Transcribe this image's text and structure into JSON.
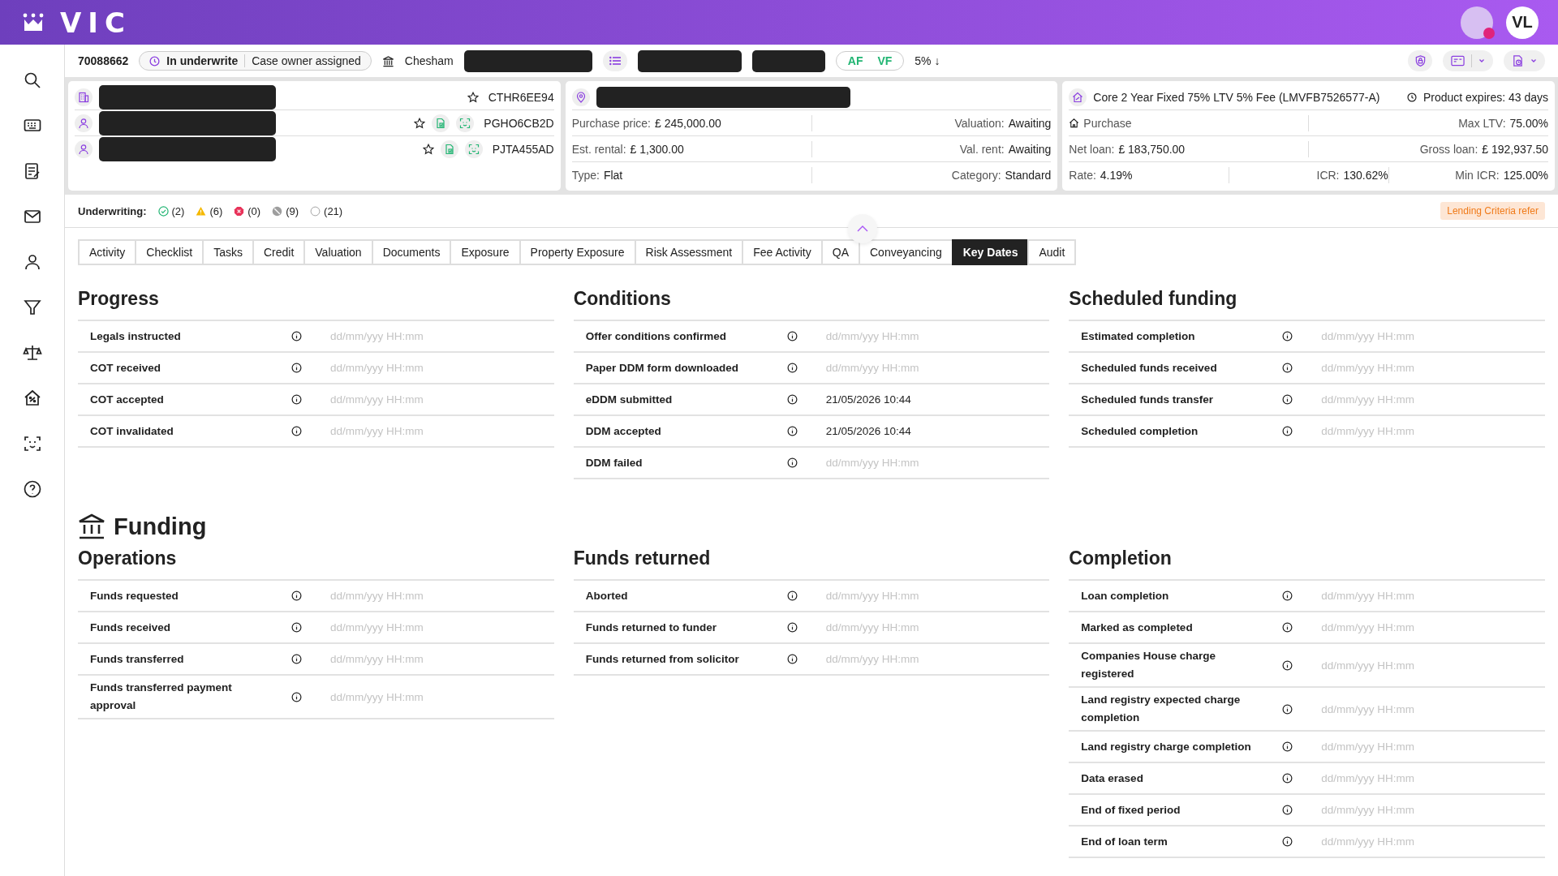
{
  "app": {
    "logo": "VIC",
    "user_initials": "VL"
  },
  "case_bar": {
    "case_number": "70088662",
    "status": "In underwrite",
    "substatus": "Case owner assigned",
    "branch": "Chesham",
    "flags": [
      "AF",
      "VF"
    ],
    "rate_change": "5% ↓"
  },
  "applicants_card": {
    "rows": [
      {
        "kind": "company",
        "reference": "CTHR6EE94",
        "starred": false,
        "has_docs": false
      },
      {
        "kind": "person",
        "reference": "PGHO6CB2D",
        "starred": false,
        "has_docs": true
      },
      {
        "kind": "person",
        "reference": "PJTA455AD",
        "starred": false,
        "has_docs": true
      }
    ]
  },
  "property_card": {
    "rows": [
      [
        {
          "label": "Purchase price:",
          "value": "£ 245,000.00"
        },
        {
          "label": "Valuation:",
          "value": "Awaiting"
        }
      ],
      [
        {
          "label": "Est. rental:",
          "value": "£ 1,300.00"
        },
        {
          "label": "Val. rent:",
          "value": "Awaiting"
        }
      ],
      [
        {
          "label": "Type:",
          "value": "Flat"
        },
        {
          "label": "Category:",
          "value": "Standard"
        }
      ]
    ]
  },
  "product_card": {
    "product": "Core 2 Year Fixed 75% LTV 5% Fee (LMVFB7526577-A)",
    "expiry": "Product expires: 43 days",
    "rows": [
      [
        {
          "label": "Purchase",
          "kind": "type"
        },
        {
          "label": "Max LTV:",
          "value": "75.00%"
        }
      ],
      [
        {
          "label": "Net loan:",
          "value": "£ 183,750.00"
        },
        {
          "label": "Gross loan:",
          "value": "£ 192,937.50"
        }
      ],
      [
        {
          "label": "Rate:",
          "value": "4.19%"
        },
        {
          "label": "ICR:",
          "value": "130.62%"
        },
        {
          "label": "Min ICR:",
          "value": "125.00%"
        }
      ]
    ]
  },
  "underwriting": {
    "label": "Underwriting:",
    "counts": [
      {
        "kind": "passed",
        "count": "(2)"
      },
      {
        "kind": "warning",
        "count": "(6)"
      },
      {
        "kind": "failed",
        "count": "(0)"
      },
      {
        "kind": "skipped",
        "count": "(9)"
      },
      {
        "kind": "pending",
        "count": "(21)"
      }
    ],
    "badge": "Lending Criteria refer"
  },
  "tabs": [
    {
      "label": "Activity",
      "selected": false
    },
    {
      "label": "Checklist",
      "selected": false
    },
    {
      "label": "Tasks",
      "selected": false
    },
    {
      "label": "Credit",
      "selected": false
    },
    {
      "label": "Valuation",
      "selected": false
    },
    {
      "label": "Documents",
      "selected": false
    },
    {
      "label": "Exposure",
      "selected": false
    },
    {
      "label": "Property Exposure",
      "selected": false
    },
    {
      "label": "Risk Assessment",
      "selected": false
    },
    {
      "label": "Fee Activity",
      "selected": false
    },
    {
      "label": "QA",
      "selected": false
    },
    {
      "label": "Conveyancing",
      "selected": false
    },
    {
      "label": "Key Dates",
      "selected": true
    },
    {
      "label": "Audit",
      "selected": false
    }
  ],
  "sections": [
    {
      "groups": [
        {
          "title": "Progress",
          "rows": [
            {
              "label": "Legals instructed",
              "placeholder": "dd/mm/yyy HH:mm"
            },
            {
              "label": "COT received",
              "placeholder": "dd/mm/yyy HH:mm"
            },
            {
              "label": "COT accepted",
              "placeholder": "dd/mm/yyy HH:mm"
            },
            {
              "label": "COT invalidated",
              "placeholder": "dd/mm/yyy HH:mm"
            }
          ]
        },
        {
          "title": "Conditions",
          "rows": [
            {
              "label": "Offer conditions confirmed",
              "placeholder": "dd/mm/yyy HH:mm"
            },
            {
              "label": "Paper DDM form downloaded",
              "placeholder": "dd/mm/yyy HH:mm"
            },
            {
              "label": "eDDM submitted",
              "value": "21/05/2026 10:44"
            },
            {
              "label": "DDM accepted",
              "value": "21/05/2026 10:44"
            },
            {
              "label": "DDM failed",
              "placeholder": "dd/mm/yyy HH:mm"
            }
          ]
        },
        {
          "title": "Scheduled funding",
          "rows": [
            {
              "label": "Estimated completion",
              "placeholder": "dd/mm/yyy HH:mm"
            },
            {
              "label": "Scheduled funds received",
              "placeholder": "dd/mm/yyy HH:mm"
            },
            {
              "label": "Scheduled funds transfer",
              "placeholder": "dd/mm/yyy HH:mm"
            },
            {
              "label": "Scheduled completion",
              "placeholder": "dd/mm/yyy HH:mm"
            }
          ]
        }
      ]
    },
    {
      "title": "Funding",
      "kind": "funding",
      "groups": [
        {
          "title": "Operations",
          "rows": [
            {
              "label": "Funds requested",
              "placeholder": "dd/mm/yyy HH:mm"
            },
            {
              "label": "Funds received",
              "placeholder": "dd/mm/yyy HH:mm"
            },
            {
              "label": "Funds transferred",
              "placeholder": "dd/mm/yyy HH:mm"
            },
            {
              "label": "Funds transferred payment approval",
              "placeholder": "dd/mm/yyy HH:mm"
            }
          ]
        },
        {
          "title": "Funds returned",
          "rows": [
            {
              "label": "Aborted",
              "placeholder": "dd/mm/yyy HH:mm"
            },
            {
              "label": "Funds returned to funder",
              "placeholder": "dd/mm/yyy HH:mm"
            },
            {
              "label": "Funds returned from solicitor",
              "placeholder": "dd/mm/yyy HH:mm"
            }
          ]
        },
        {
          "title": "Completion",
          "rows": [
            {
              "label": "Loan completion",
              "placeholder": "dd/mm/yyy HH:mm"
            },
            {
              "label": "Marked as completed",
              "placeholder": "dd/mm/yyy HH:mm"
            },
            {
              "label": "Companies House charge registered",
              "placeholder": "dd/mm/yyy HH:mm"
            },
            {
              "label": "Land registry expected charge completion",
              "placeholder": "dd/mm/yyy HH:mm"
            },
            {
              "label": "Land registry charge completion",
              "placeholder": "dd/mm/yyy HH:mm"
            },
            {
              "label": "Data erased",
              "placeholder": "dd/mm/yyy HH:mm"
            },
            {
              "label": "End of fixed period",
              "placeholder": "dd/mm/yyy HH:mm"
            },
            {
              "label": "End of loan term",
              "placeholder": "dd/mm/yyy HH:mm"
            }
          ]
        }
      ]
    }
  ]
}
